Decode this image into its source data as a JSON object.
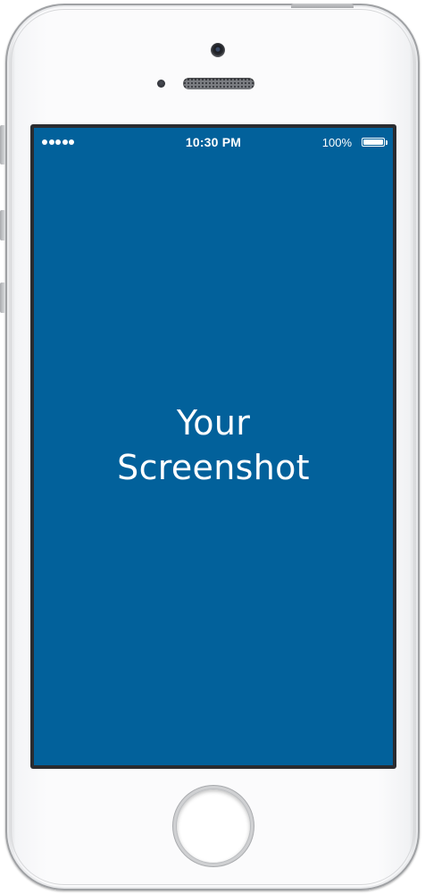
{
  "device": {
    "model": "iphone-white"
  },
  "status_bar": {
    "signal_dots": 5,
    "time": "10:30 PM",
    "battery_percent_text": "100%",
    "battery_level": 1.0
  },
  "screen": {
    "background_color": "#02619b",
    "placeholder_line1": "Your",
    "placeholder_line2": "Screenshot"
  },
  "icons": {
    "signal": "signal-dots-icon",
    "battery": "battery-icon",
    "camera": "front-camera-icon",
    "speaker": "speaker-grille-icon",
    "home": "home-button"
  }
}
